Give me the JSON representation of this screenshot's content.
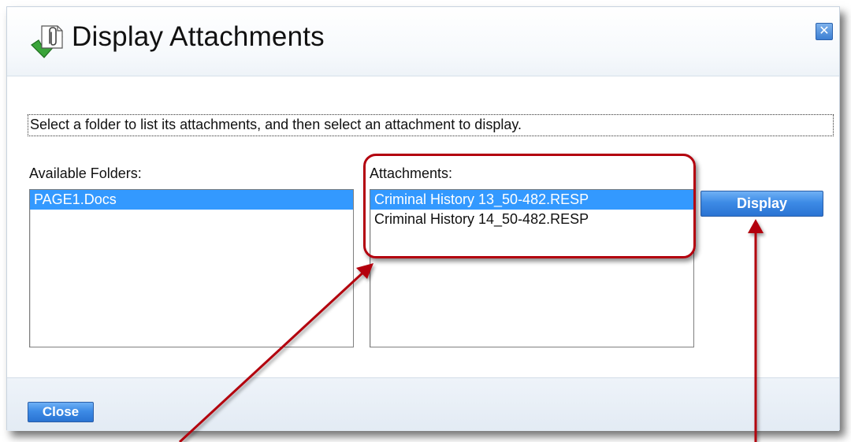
{
  "dialog": {
    "title": "Display Attachments",
    "close_glyph": "✕",
    "instruction": "Select a folder to list its attachments, and then select an attachment to display."
  },
  "folders": {
    "label": "Available Folders:",
    "items": [
      "PAGE1.Docs"
    ],
    "selected_index": 0
  },
  "attachments": {
    "label": "Attachments:",
    "items": [
      "Criminal History 13_50-482.RESP",
      "Criminal History 14_50-482.RESP"
    ],
    "selected_index": 0
  },
  "buttons": {
    "display_label": "Display",
    "close_label": "Close"
  },
  "icons": {
    "title_icon": "attachment-icon",
    "close_icon": "close-icon"
  },
  "colors": {
    "selection": "#3399ff",
    "button": "#3d8be6",
    "annotation": "#b3000e"
  }
}
